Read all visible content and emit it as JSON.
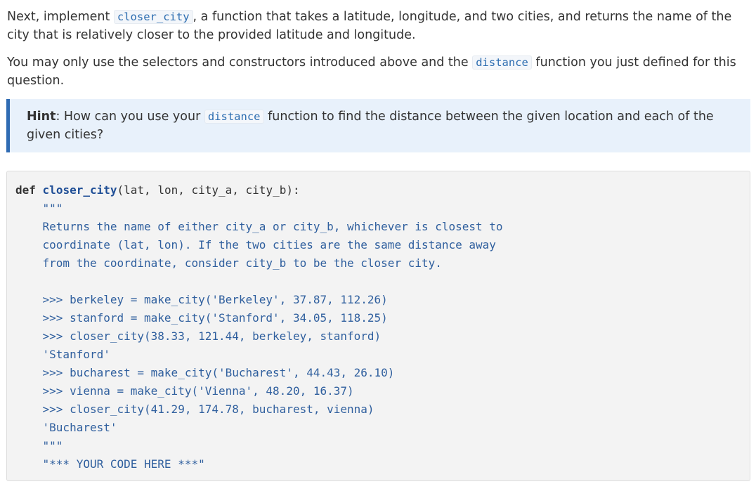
{
  "para1": {
    "before": "Next, implement ",
    "code": "closer_city",
    "after": ", a function that takes a latitude, longitude, and two cities, and returns the name of the city that is relatively closer to the provided latitude and longitude."
  },
  "para2": {
    "before": "You may only use the selectors and constructors introduced above and the ",
    "code": "distance",
    "after": " function you just defined for this question."
  },
  "hint": {
    "label": "Hint",
    "colon": ": How can you use your ",
    "code": "distance",
    "after": " function to find the distance between the given location and each of the given cities?"
  },
  "code": {
    "keyword": "def",
    "func_name": "closer_city",
    "signature": "(lat, lon, city_a, city_b):",
    "lines": [
      "    \"\"\"",
      "    Returns the name of either city_a or city_b, whichever is closest to",
      "    coordinate (lat, lon). If the two cities are the same distance away",
      "    from the coordinate, consider city_b to be the closer city.",
      "",
      "    >>> berkeley = make_city('Berkeley', 37.87, 112.26)",
      "    >>> stanford = make_city('Stanford', 34.05, 118.25)",
      "    >>> closer_city(38.33, 121.44, berkeley, stanford)",
      "    'Stanford'",
      "    >>> bucharest = make_city('Bucharest', 44.43, 26.10)",
      "    >>> vienna = make_city('Vienna', 48.20, 16.37)",
      "    >>> closer_city(41.29, 174.78, bucharest, vienna)",
      "    'Bucharest'",
      "    \"\"\"",
      "    \"*** YOUR CODE HERE ***\""
    ]
  }
}
